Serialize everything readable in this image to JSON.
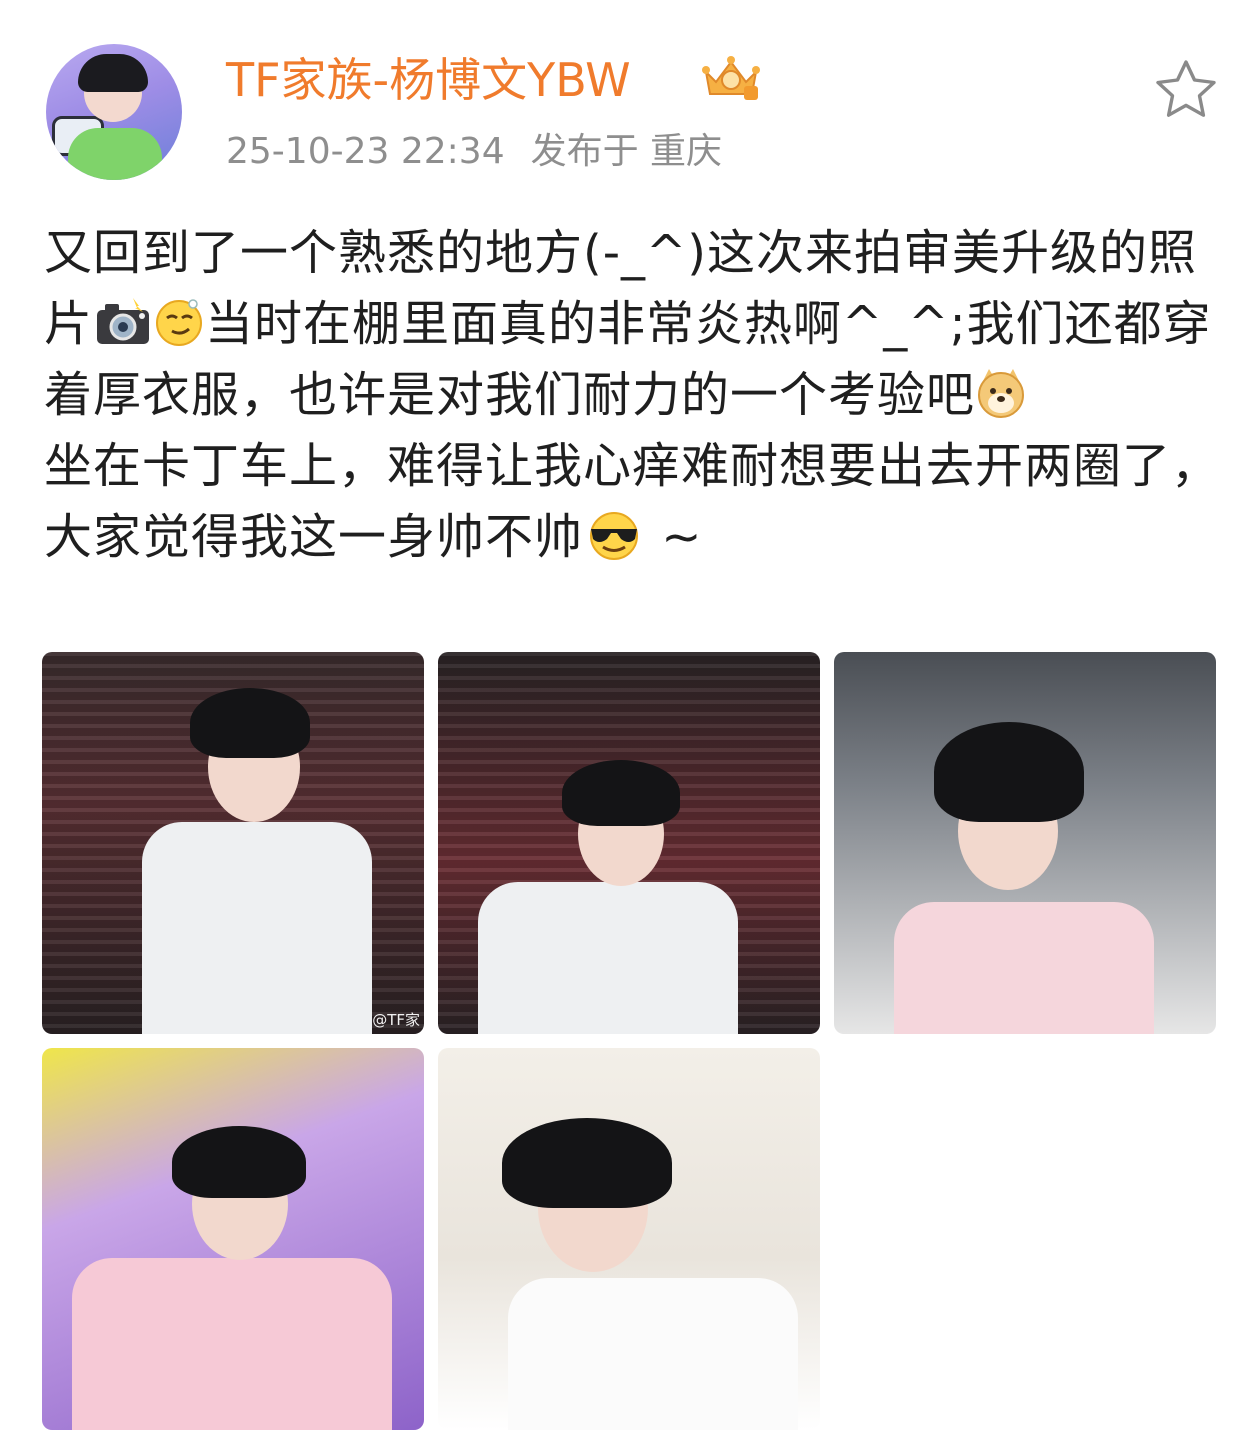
{
  "post": {
    "author": "TF家族-杨博文YBW",
    "timestamp": "25-10-23 22:34",
    "location": "发布于 重庆",
    "paragraph1": {
      "part1": "又回到了一个熟悉的地方(-_^)这次来拍审美升级的照片",
      "part2": "当时在棚里面真的非常炎热啊^_^;我们还都穿着厚衣服，也许是对我们耐力的一个考验吧"
    },
    "paragraph2": {
      "part1": "坐在卡丁车上，难得让我心痒难耐想要出去开两圈了，大家觉得我这一身帅不帅",
      "part2": " ~"
    },
    "photo_watermark": "@TF家",
    "icons": {
      "avatar": "user-avatar",
      "badge": "crown-badge-icon",
      "favorite": "star-outline-icon",
      "emoji1": "camera-flash-emoji",
      "emoji2": "smug-face-emoji",
      "emoji3": "doge-emoji",
      "emoji4": "sunglasses-face-emoji"
    },
    "colors": {
      "author": "#f07b2c",
      "meta": "#8e8e8e",
      "text": "#1f1f1f"
    }
  }
}
